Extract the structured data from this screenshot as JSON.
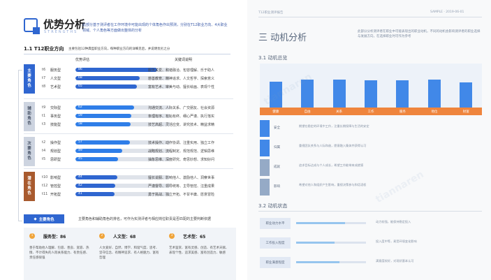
{
  "left": {
    "title": "优势分析",
    "title_en": "STRENGTHS",
    "intro": "此部分基于测评者在工作环境中可能出现的个体角色作出预测，分别在T12职业方向、4大职业领域、个人角色等方面做出整体的分析",
    "section": {
      "number": "1.1 T12职业方向",
      "note": "主要包括12种典型职业方向，每种职业方向的详细见后，并说明优劣之分"
    },
    "columns": {
      "score": "优势评估",
      "keywords": "关键词说明"
    },
    "groups": [
      {
        "label": "主要角色",
        "color": "#2f66d0",
        "icon": "bulb-icon",
        "rows": [
          {
            "code": "t6",
            "name": "服务型",
            "value": 86,
            "keywords": "服务关爱、和谐融洽、包容理解、乐于助人"
          },
          {
            "code": "t7",
            "name": "人文型",
            "value": 68,
            "keywords": "慈善教育、精神追求、人文哲学、探索意义"
          },
          {
            "code": "t8",
            "name": "艺术型",
            "value": 65,
            "keywords": "富有艺术、审美与动、擅长绘画、表现个性"
          }
        ]
      },
      {
        "label": "辅助角色",
        "color": "#cdd4e0",
        "rows": [
          {
            "code": "t9",
            "name": "交际型",
            "value": 62,
            "keywords": "沟通交流、人际关系、广交朋友、社会资源"
          },
          {
            "code": "t1",
            "name": "事务型",
            "value": 59,
            "keywords": "条理有序、有始有终、细心严谨、执行落实"
          },
          {
            "code": "t3",
            "name": "技能型",
            "value": 58,
            "keywords": "技艺高超、灵活应变、讲究技术、精益求精"
          }
        ]
      },
      {
        "label": "次要角色",
        "color": "#cdd4e0",
        "rows": [
          {
            "code": "t2",
            "name": "操作型",
            "value": 57,
            "keywords": "技术操作、动作协调、注重实用、独立工作"
          },
          {
            "code": "t4",
            "name": "规划型",
            "value": 49,
            "keywords": "战略规划、流程制定、规范规范、逻辑思维"
          },
          {
            "code": "t5",
            "name": "思研型",
            "value": 45,
            "keywords": "抽象思维、深度研究、奇思妙想、求知好问"
          }
        ]
      },
      {
        "label": "潜在角色",
        "color": "#a85a2e",
        "rows": [
          {
            "code": "t10",
            "name": "影响型",
            "value": 44,
            "keywords": "擅长说服、影响他人、激励他人、洞察世事"
          },
          {
            "code": "t12",
            "name": "管控型",
            "value": 42,
            "keywords": "严谨督导、领导统筹、主导管控、注重成果"
          },
          {
            "code": "t11",
            "name": "开拓型",
            "value": 41,
            "keywords": "勇于挑战、独立开拓、不甘平庸、愿意冒险"
          }
        ]
      }
    ],
    "main_role": {
      "label": "主要角色",
      "note": "主要角色和辅助角色的排名，可作为实测评者与相应岗位职责是否匹配的主要判断依据",
      "cards": [
        {
          "rank": "1",
          "title": "服务型：86",
          "desc": "善于帮助他人理解、包容、善良、宽容、热情、不计得失的人际关系能力、有责任感、责任感很强"
        },
        {
          "rank": "2",
          "title": "人文型：68",
          "desc": "人文爱好、自然、博学、和谐气度、思考、坚守信念、有精神追求、有人格魅力、富有哲理"
        },
        {
          "rank": "3",
          "title": "艺术型：65",
          "desc": "艺术鉴赏、富有灵感、创造、有艺术天赋、表现个性、追求美感、富有创造力、敏感"
        }
      ]
    }
  },
  "right": {
    "header_left": "T12职业测评报告",
    "header_right": "SAMPLE · 2019-06-01",
    "title": "三  动机分析",
    "intro": "此部分分析测评者在职业中可能表现出的职业动机，不同的动机会影响测评者的职业选择与发展方向，在选择职业时可作为参考",
    "sec1": "3.1 动机总览",
    "sec2": "3.2 动机状态",
    "chart_data": {
      "type": "bar",
      "categories": [
        "健康",
        "自由",
        "关系",
        "工作",
        "服务",
        "地位",
        "财富"
      ],
      "values": [
        68,
        74,
        74,
        72,
        73,
        74,
        66
      ],
      "ylim": [
        0,
        100
      ]
    },
    "motives": [
      {
        "name": "安全",
        "color": "#2f7ee8",
        "text": "期望在稳定的环境中工作，注重长期保障与生活的安定"
      },
      {
        "name": "归属",
        "color": "#2f7ee8",
        "text": "重视团队关系与人际和谐，愿意融入集体并获得认可"
      },
      {
        "name": "成就",
        "color": "#8da4c2",
        "text": "追求目标达成与个人成长，希望工作能带来成就感"
      },
      {
        "name": "影响",
        "color": "#8da4c2",
        "text": "希望对他人和组织产生影响，重视决策参与和话语权"
      }
    ],
    "states": [
      {
        "name": "职业动力水平",
        "level": 0.7,
        "text": "动力较强，能保持稳定投入"
      },
      {
        "name": "工作投入程度",
        "level": 0.55,
        "text": "投入度中等，易受环境变化影响"
      },
      {
        "name": "职业满意程度",
        "level": 0.62,
        "text": "满意度较好，对现状基本认可"
      }
    ]
  }
}
